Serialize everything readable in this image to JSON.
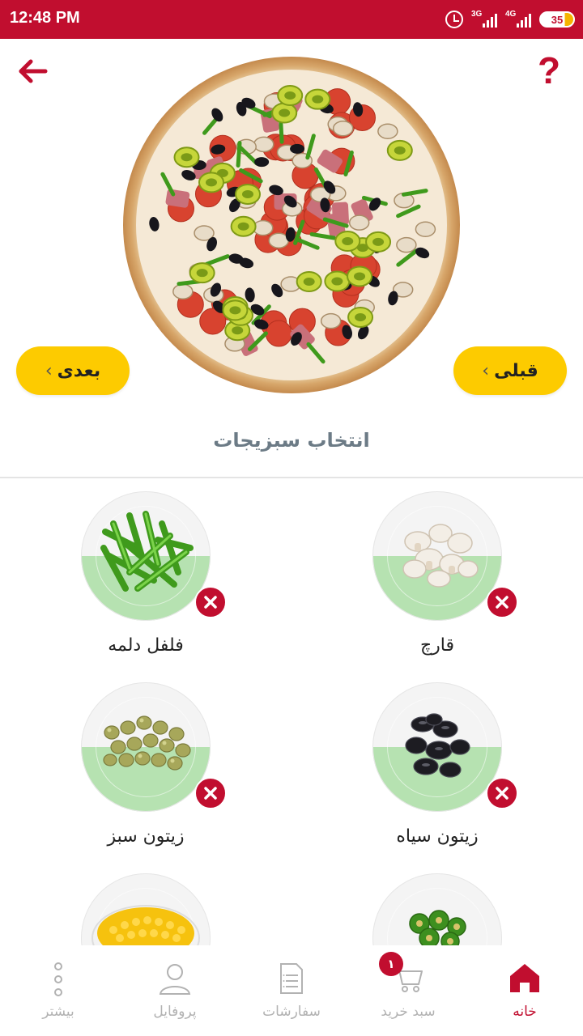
{
  "status_bar": {
    "time": "12:48 PM",
    "net1": "3G",
    "net2": "4G",
    "battery": "35"
  },
  "header": {
    "back_icon": "arrow-left-icon",
    "help_label": "?"
  },
  "pizza": {
    "icon": "pizza-image"
  },
  "navigation": {
    "next_label": "بعدی",
    "prev_label": "قبلی"
  },
  "section": {
    "title": "انتخاب سبزیجات"
  },
  "vegetables": [
    {
      "name": "قارچ",
      "image": "mushroom-image"
    },
    {
      "name": "فلفل دلمه",
      "image": "bell-pepper-image"
    },
    {
      "name": "زیتون سیاه",
      "image": "black-olive-image"
    },
    {
      "name": "زیتون سبز",
      "image": "green-olive-image"
    },
    {
      "name": "",
      "image": "jalapeno-image"
    },
    {
      "name": "",
      "image": "corn-image"
    }
  ],
  "bottom_nav": {
    "items": [
      {
        "label": "خانه",
        "icon": "home-icon",
        "active": true
      },
      {
        "label": "سبد خرید",
        "icon": "cart-icon",
        "badge": "۱"
      },
      {
        "label": "سفارشات",
        "icon": "orders-icon"
      },
      {
        "label": "پروفایل",
        "icon": "profile-icon"
      },
      {
        "label": "بیشتر",
        "icon": "more-icon"
      }
    ]
  },
  "colors": {
    "brand_red": "#c10e2f",
    "button_yellow": "#fdcb00",
    "selected_green": "#b6e2b1",
    "title_gray": "#6c7b86"
  }
}
